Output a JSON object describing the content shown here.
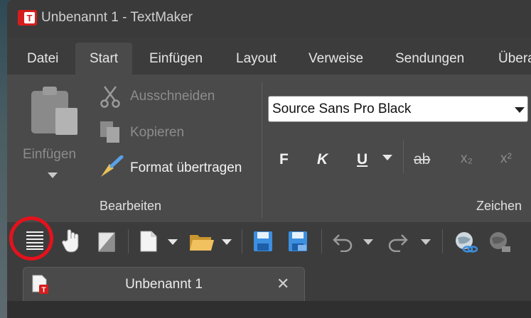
{
  "window": {
    "title": "Unbenannt 1 - TextMaker"
  },
  "menu": {
    "tabs": [
      {
        "label": "Datei"
      },
      {
        "label": "Start"
      },
      {
        "label": "Einfügen"
      },
      {
        "label": "Layout"
      },
      {
        "label": "Verweise"
      },
      {
        "label": "Sendungen"
      },
      {
        "label": "Überarbeiten"
      }
    ],
    "active": "Start"
  },
  "ribbon": {
    "paste_label": "Einfügen",
    "cut_label": "Ausschneiden",
    "copy_label": "Kopieren",
    "format_painter_label": "Format übertragen",
    "edit_group_label": "Bearbeiten",
    "font_group_label": "Zeichen",
    "font_name": "Source Sans Pro Black",
    "bold_label": "F",
    "italic_label": "K",
    "underline_label": "U",
    "strike_label": "ab",
    "subscript_label": "x₂",
    "superscript_label": "x²"
  },
  "document_tab": {
    "label": "Unbenannt 1"
  },
  "colors": {
    "accent_red": "#e4121c",
    "ribbon_bg": "#4a4a4a",
    "window_bg": "#3c3c3c",
    "save_blue": "#3d8fe0",
    "folder_yellow": "#e8b64c"
  },
  "icons": [
    "app-logo-icon",
    "paste-icon",
    "scissors-icon",
    "copy-icon",
    "brush-icon",
    "menu-lines-icon",
    "hand-icon",
    "contrast-icon",
    "new-doc-icon",
    "folder-icon",
    "save-icon",
    "save-as-icon",
    "undo-icon",
    "redo-icon",
    "globe-link-icon",
    "globe-offline-icon",
    "doc-red-icon",
    "close-icon"
  ]
}
